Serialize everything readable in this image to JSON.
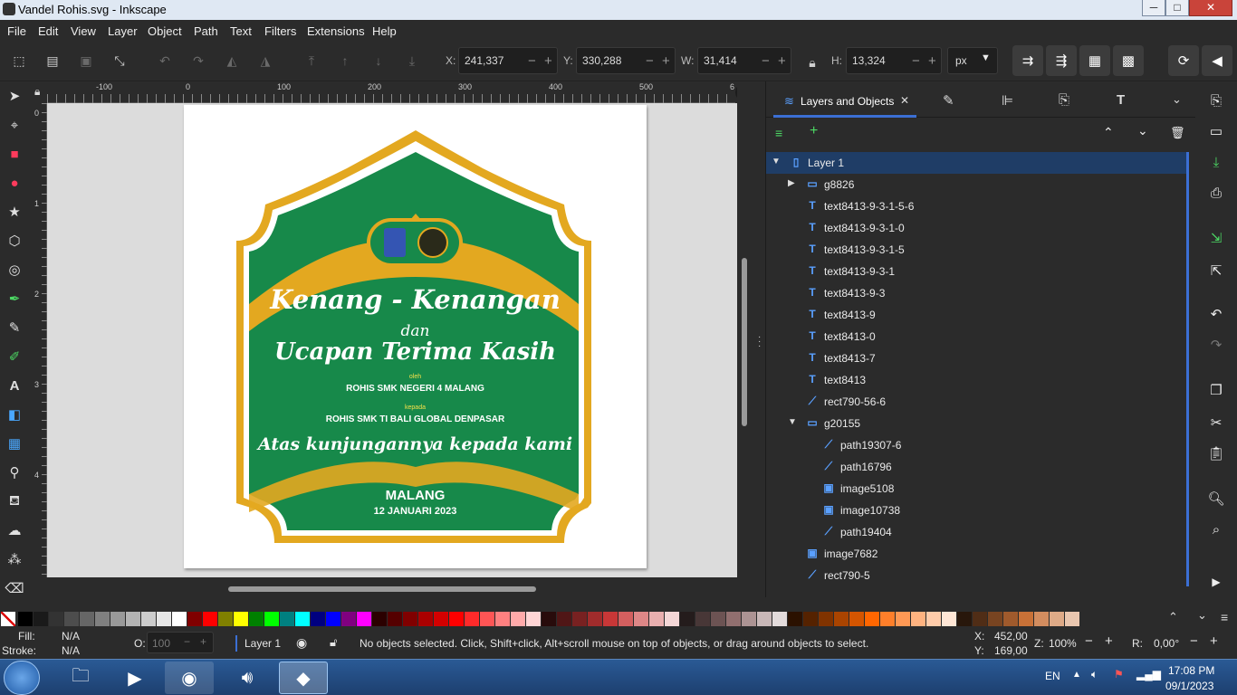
{
  "window": {
    "title": "Vandel Rohis.svg - Inkscape",
    "min_label": "─",
    "max_label": "□",
    "close_label": "✕"
  },
  "menubar": [
    "File",
    "Edit",
    "View",
    "Layer",
    "Object",
    "Path",
    "Text",
    "Filters",
    "Extensions",
    "Help"
  ],
  "toolctl": {
    "x_label": "X:",
    "x_value": "241,337",
    "y_label": "Y:",
    "y_value": "330,288",
    "w_label": "W:",
    "w_value": "31,414",
    "h_label": "H:",
    "h_value": "13,324",
    "unit": "px"
  },
  "rulers": {
    "h_labels": [
      "-100",
      "0",
      "100",
      "200",
      "300",
      "400",
      "500",
      "6"
    ],
    "v_labels": [
      "0",
      "1",
      "2",
      "3",
      "4"
    ]
  },
  "design": {
    "title1": "Kenang - Kenangan",
    "conj": "dan",
    "title2": "Ucapan Terima Kasih",
    "oleh": "oleh",
    "from": "ROHIS SMK NEGERI 4 MALANG",
    "kepada": "kepada",
    "to": "ROHIS SMK TI BALI GLOBAL DENPASAR",
    "thanks": "Atas kunjungannya kepada kami",
    "city": "MALANG",
    "date": "12 JANUARI 2023"
  },
  "panel": {
    "tab_label": "Layers and Objects",
    "tab_close": "✕",
    "rows": [
      {
        "label": "Layer 1",
        "icon": "layer"
      },
      {
        "label": "g8826",
        "icon": "group"
      },
      {
        "label": "text8413-9-3-1-5-6",
        "icon": "text"
      },
      {
        "label": "text8413-9-3-1-0",
        "icon": "text"
      },
      {
        "label": "text8413-9-3-1-5",
        "icon": "text"
      },
      {
        "label": "text8413-9-3-1",
        "icon": "text"
      },
      {
        "label": "text8413-9-3",
        "icon": "text"
      },
      {
        "label": "text8413-9",
        "icon": "text"
      },
      {
        "label": "text8413-0",
        "icon": "text"
      },
      {
        "label": "text8413-7",
        "icon": "text"
      },
      {
        "label": "text8413",
        "icon": "text"
      },
      {
        "label": "rect790-56-6",
        "icon": "path"
      },
      {
        "label": "g20155",
        "icon": "group"
      },
      {
        "label": "path19307-6",
        "icon": "path"
      },
      {
        "label": "path16796",
        "icon": "path"
      },
      {
        "label": "image5108",
        "icon": "image"
      },
      {
        "label": "image10738",
        "icon": "image"
      },
      {
        "label": "path19404",
        "icon": "path"
      },
      {
        "label": "image7682",
        "icon": "image"
      },
      {
        "label": "rect790-5",
        "icon": "path"
      }
    ]
  },
  "status": {
    "fill_label": "Fill:",
    "fill_value": "N/A",
    "stroke_label": "Stroke:",
    "stroke_value": "N/A",
    "opacity_label": "O:",
    "opacity_value": "100",
    "layer": "Layer 1",
    "message": "No objects selected. Click, Shift+click, Alt+scroll mouse on top of objects, or drag around objects to select.",
    "cx_label": "X:",
    "cx_value": "452,00",
    "cy_label": "Y:",
    "cy_value": "169,00",
    "zoom_label": "Z:",
    "zoom_value": "100%",
    "rot_label": "R:",
    "rot_value": "0,00°"
  },
  "taskbar": {
    "lang": "EN",
    "time": "17:08 PM",
    "date": "09/1/2023"
  },
  "colors": {
    "accent": "#3b6fd4",
    "design_green": "#17894a",
    "design_gold": "#e3a820"
  }
}
